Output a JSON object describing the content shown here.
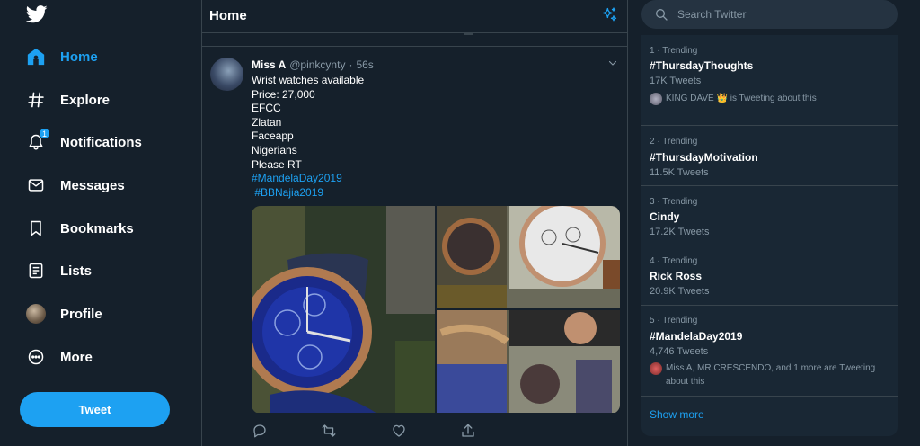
{
  "nav": {
    "home": "Home",
    "explore": "Explore",
    "notifications": "Notifications",
    "notifications_badge": "1",
    "messages": "Messages",
    "bookmarks": "Bookmarks",
    "lists": "Lists",
    "profile": "Profile",
    "more": "More",
    "tweet_button": "Tweet"
  },
  "main": {
    "title": "Home"
  },
  "tweet": {
    "name": "Miss A",
    "handle": "@pinkcynty",
    "separator": "·",
    "time": "56s",
    "lines": [
      "Wrist watches available",
      "Price: 27,000",
      "EFCC",
      "Zlatan",
      "Faceapp",
      "Nigerians",
      "Please RT"
    ],
    "hashtags": [
      "#MandelaDay2019",
      " #BBNajia2019"
    ]
  },
  "search": {
    "placeholder": "Search Twitter"
  },
  "trends": [
    {
      "meta": "1 · Trending",
      "tag": "#ThursdayThoughts",
      "count": "17K Tweets",
      "tweeting": "KING DAVE 👑 is Tweeting about this"
    },
    {
      "meta": "2 · Trending",
      "tag": "#ThursdayMotivation",
      "count": "11.5K Tweets"
    },
    {
      "meta": "3 · Trending",
      "tag": "Cindy",
      "count": "17.2K Tweets"
    },
    {
      "meta": "4 · Trending",
      "tag": "Rick Ross",
      "count": "20.9K Tweets"
    },
    {
      "meta": "5 · Trending",
      "tag": "#MandelaDay2019",
      "count": "4,746 Tweets",
      "tweeting_1": "Miss A, MR.CRESCENDO, and 1 more are Tweeting",
      "tweeting_2": "about this"
    }
  ],
  "show_more": "Show more",
  "colors": {
    "background": "#15202b",
    "accent": "#1da1f2",
    "secondary_text": "#8899a6",
    "border": "#38444d",
    "panel": "#192734"
  }
}
